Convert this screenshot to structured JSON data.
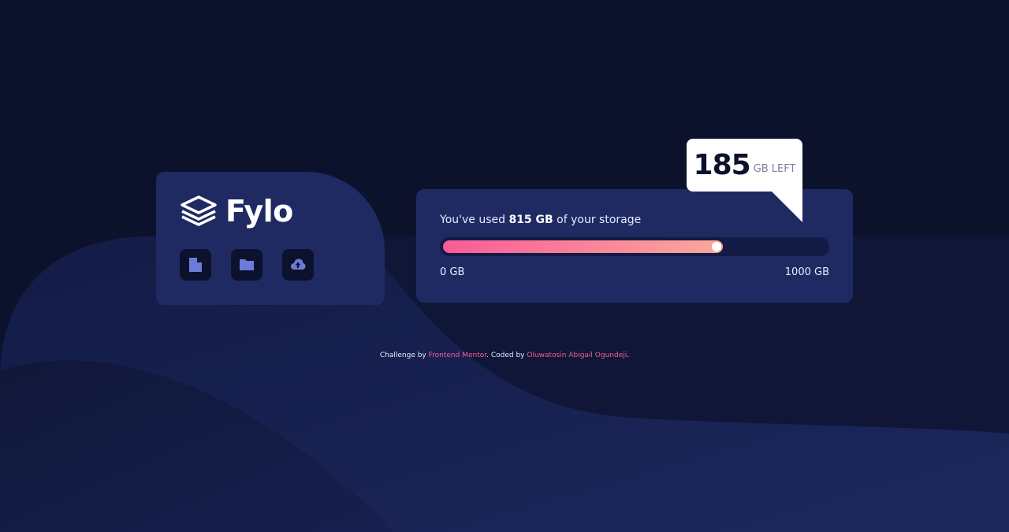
{
  "brand": {
    "name": "Fylo",
    "logo_icon": "stacked-layers-logo"
  },
  "actions": [
    {
      "icon": "document-icon",
      "label": ""
    },
    {
      "icon": "folder-icon",
      "label": ""
    },
    {
      "icon": "upload-icon",
      "label": ""
    }
  ],
  "storage": {
    "used_prefix": "You've used ",
    "used_value": "815 GB",
    "used_suffix": " of your storage",
    "min_label": "0 GB",
    "max_label": "1000 GB",
    "used_fraction": 0.73
  },
  "remaining": {
    "value": "185",
    "unit": "GB LEFT"
  },
  "attribution": {
    "prefix": "Challenge by ",
    "challenge_link": "Frontend Mentor",
    "middle": ". Coded by ",
    "author_link": "Oluwatosin Abigail Ogundeji",
    "suffix": "."
  },
  "colors": {
    "background": "#0c122c",
    "card": "#1f2a63",
    "accent_pink": "#f95c97",
    "accent_peach": "#fba89a",
    "icon": "#6d7bd8"
  }
}
